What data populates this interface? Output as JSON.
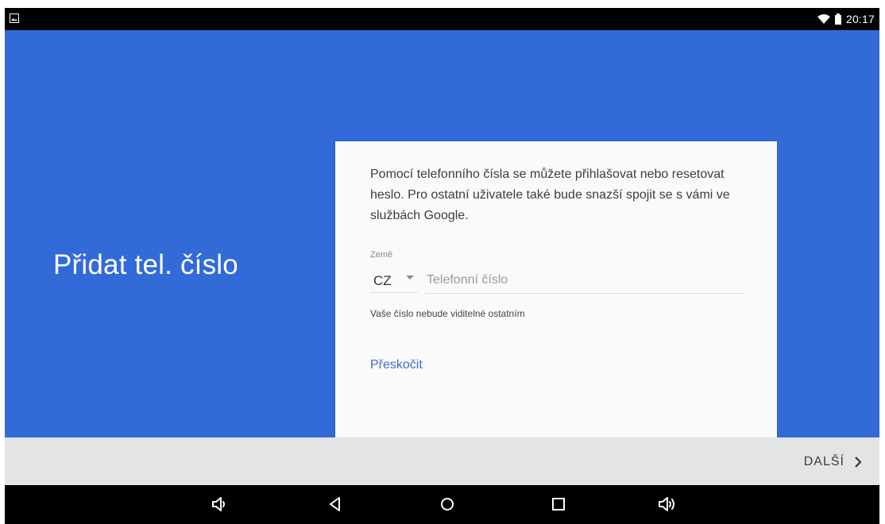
{
  "status_bar": {
    "time": "20:17",
    "left_icon": "image-icon",
    "wifi_icon": "wifi-icon",
    "battery_icon": "battery-icon"
  },
  "page": {
    "title": "Přidat tel. číslo"
  },
  "card": {
    "description": "Pomocí telefonního čísla se můžete přihlašovat nebo resetovat heslo. Pro ostatní uživatele také bude snazší spojit se s vámi ve službách Google.",
    "country_label": "Země",
    "country_value": "CZ",
    "phone_placeholder": "Telefonní číslo",
    "phone_value": "",
    "helper_text": "Vaše číslo nebude viditelné ostatním",
    "skip_label": "Přeskočit"
  },
  "footer": {
    "next_label": "DALŠÍ",
    "next_icon": "chevron-right-icon"
  },
  "nav_bar": {
    "buttons": [
      "volume-down-icon",
      "back-icon",
      "home-icon",
      "recents-icon",
      "volume-up-icon"
    ]
  },
  "colors": {
    "primary_blue": "#326ad8",
    "card_background": "#fafafa",
    "link_blue": "#3b6fcf",
    "footer_gray": "#e3e4e5",
    "system_bar": "#000000"
  }
}
